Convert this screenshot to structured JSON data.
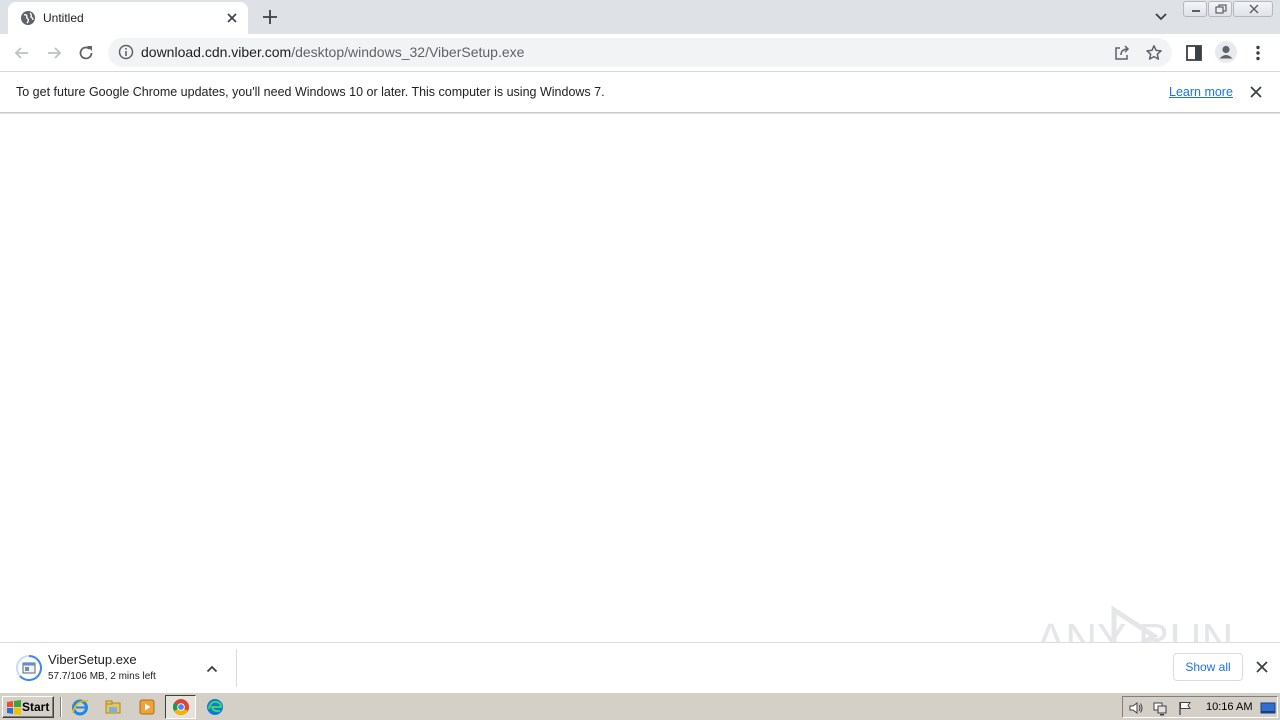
{
  "browser": {
    "tab": {
      "title": "Untitled",
      "favicon": "globe-icon"
    },
    "url": {
      "host": "download.cdn.viber.com",
      "path": "/desktop/windows_32/ViberSetup.exe"
    },
    "icons": [
      "back-arrow-icon",
      "forward-arrow-icon",
      "reload-icon",
      "info-icon",
      "share-icon",
      "star-icon",
      "side-panel-icon",
      "profile-icon",
      "kebab-menu-icon"
    ]
  },
  "infobar": {
    "message": "To get future Google Chrome updates, you'll need Windows 10 or later. This computer is using Windows 7.",
    "link": "Learn more"
  },
  "download_shelf": {
    "file_name": "ViberSetup.exe",
    "status": "57.7/106 MB, 2 mins left",
    "show_all": "Show all"
  },
  "watermark": "ANY RUN",
  "taskbar": {
    "start_label": "Start",
    "pinned": [
      "ie-icon",
      "explorer-icon",
      "media-player-icon",
      "chrome-icon",
      "edge-icon"
    ],
    "clock": "10:16 AM"
  },
  "colors": {
    "accent": "#1a73e8",
    "tabstrip": "#dee1e6",
    "taskbar": "#d4d0c8"
  }
}
